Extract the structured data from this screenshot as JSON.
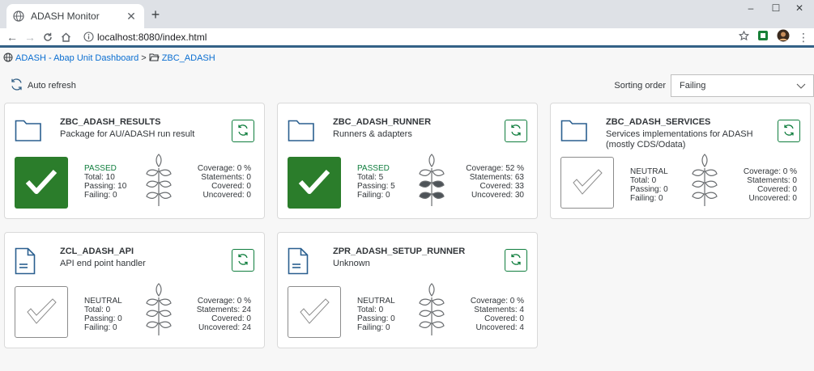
{
  "browser": {
    "tab_title": "ADASH Monitor",
    "new_tab": "+",
    "url": "localhost:8080/index.html",
    "controls": {
      "minimize": "–",
      "maximize": "☐",
      "close": "✕",
      "tab_close": "✕"
    }
  },
  "breadcrumb": {
    "root": "ADASH - Abap Unit Dashboard",
    "separator": ">",
    "current": "ZBC_ADASH"
  },
  "toolbar": {
    "auto_refresh": "Auto refresh",
    "sorting_label": "Sorting order",
    "sorting_value": "Failing"
  },
  "colors": {
    "passed": "#2b7d2b",
    "accent": "#346187",
    "link": "#0a6ed1",
    "refresh_border": "#107e3e"
  },
  "cards": [
    {
      "icon": "folder-icon",
      "title": "ZBC_ADASH_RESULTS",
      "description": "Package for AU/ADASH run result",
      "status": "PASSED",
      "total": "Total: 10",
      "passing": "Passing: 10",
      "failing": "Failing: 0",
      "coverage": "Coverage: 0 %",
      "statements": "Statements: 0",
      "covered": "Covered: 0",
      "uncovered": "Uncovered: 0",
      "coverage_level": 0
    },
    {
      "icon": "folder-icon",
      "title": "ZBC_ADASH_RUNNER",
      "description": "Runners & adapters",
      "status": "PASSED",
      "total": "Total: 5",
      "passing": "Passing: 5",
      "failing": "Failing: 0",
      "coverage": "Coverage: 52 %",
      "statements": "Statements: 63",
      "covered": "Covered: 33",
      "uncovered": "Uncovered: 30",
      "coverage_level": 52
    },
    {
      "icon": "folder-icon",
      "title": "ZBC_ADASH_SERVICES",
      "description": "Services implementations for ADASH (mostly CDS/Odata)",
      "status": "NEUTRAL",
      "total": "Total: 0",
      "passing": "Passing: 0",
      "failing": "Failing: 0",
      "coverage": "Coverage: 0 %",
      "statements": "Statements: 0",
      "covered": "Covered: 0",
      "uncovered": "Uncovered: 0",
      "coverage_level": 0
    },
    {
      "icon": "document-icon",
      "title": "ZCL_ADASH_API",
      "description": "API end point handler",
      "status": "NEUTRAL",
      "total": "Total: 0",
      "passing": "Passing: 0",
      "failing": "Failing: 0",
      "coverage": "Coverage: 0 %",
      "statements": "Statements: 24",
      "covered": "Covered: 0",
      "uncovered": "Uncovered: 24",
      "coverage_level": 0
    },
    {
      "icon": "document-icon",
      "title": "ZPR_ADASH_SETUP_RUNNER",
      "description": "Unknown",
      "status": "NEUTRAL",
      "total": "Total: 0",
      "passing": "Passing: 0",
      "failing": "Failing: 0",
      "coverage": "Coverage: 0 %",
      "statements": "Statements: 4",
      "covered": "Covered: 0",
      "uncovered": "Uncovered: 4",
      "coverage_level": 0
    }
  ]
}
